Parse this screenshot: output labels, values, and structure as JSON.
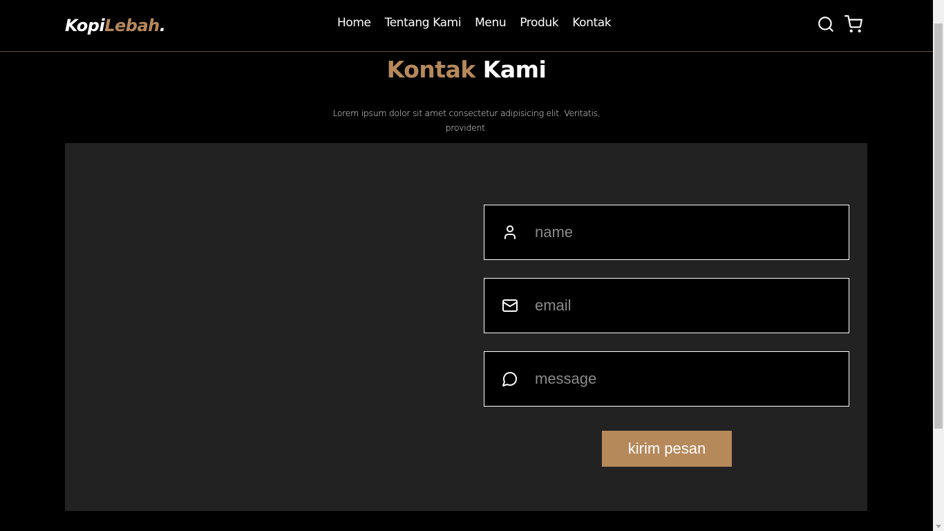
{
  "brand": {
    "name_part1": "Kopi",
    "name_part2": "Lebah",
    "name_part3": "."
  },
  "nav": {
    "links": [
      {
        "label": "Home"
      },
      {
        "label": "Tentang Kami"
      },
      {
        "label": "Menu"
      },
      {
        "label": "Produk"
      },
      {
        "label": "Kontak"
      }
    ],
    "icons": [
      "search-icon",
      "shopping-cart-icon"
    ]
  },
  "section": {
    "title_accent": "Kontak",
    "title_rest": "Kami",
    "subtitle": "Lorem ipsum dolor sit amet consectetur adipisicing elit. Veritatis, provident."
  },
  "form": {
    "name_placeholder": "name",
    "email_placeholder": "email",
    "message_placeholder": "message",
    "submit_label": "kirim pesan",
    "icons": [
      "user-icon",
      "mail-icon",
      "message-circle-icon"
    ]
  },
  "colors": {
    "accent": "#b6895b",
    "background": "#000000",
    "panel": "#222222"
  }
}
